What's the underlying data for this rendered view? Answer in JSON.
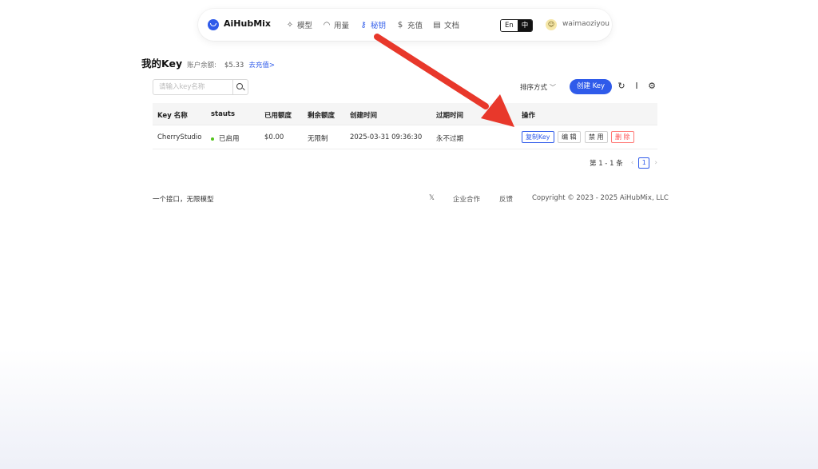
{
  "nav": {
    "brand": "AiHubMix",
    "items": [
      {
        "label": "模型",
        "icon": "sparkle-icon",
        "glyph": "✧",
        "active": false
      },
      {
        "label": "用量",
        "icon": "gauge-icon",
        "glyph": "◠",
        "active": false
      },
      {
        "label": "秘钥",
        "icon": "key-icon",
        "glyph": "⚷",
        "active": true
      },
      {
        "label": "充值",
        "icon": "coin-icon",
        "glyph": "$",
        "active": false
      },
      {
        "label": "文档",
        "icon": "document-icon",
        "glyph": "▤",
        "active": false
      }
    ],
    "lang_en": "En",
    "lang_zh": "中",
    "avatar_glyph": "☺",
    "username": "waimaoziyou"
  },
  "header": {
    "title": "我的Key",
    "balance_label": "账户余额:",
    "balance_value": "$5.33",
    "recharge_link": "去充值>"
  },
  "search": {
    "placeholder": "请输入key名称"
  },
  "toolbar": {
    "sort_label": "排序方式",
    "create_button": "创建 Key"
  },
  "table": {
    "headers": {
      "name": "Key 名称",
      "status": "stauts",
      "used": "已用额度",
      "remaining": "剩余额度",
      "created": "创建时间",
      "expires": "过期时间",
      "actions": "操作"
    },
    "rows": [
      {
        "name": "CherryStudio",
        "status": "已启用",
        "used": "$0.00",
        "remaining": "无限制",
        "created": "2025-03-31 09:36:30",
        "expires": "永不过期",
        "actions": {
          "copy": "复制Key",
          "edit": "编 辑",
          "disable": "禁 用",
          "delete": "删 除"
        }
      }
    ]
  },
  "pagination": {
    "summary": "第 1 - 1 条",
    "current_page": "1"
  },
  "footer": {
    "slogan": "一个接口，无限模型",
    "x_icon": "𝕏",
    "business": "企业合作",
    "feedback": "反馈",
    "copyright": "Copyright © 2023 - 2025 AiHubMix, LLC"
  },
  "colors": {
    "accent": "#2f5bea",
    "status_active": "#52c41a",
    "danger": "#ff4d4f",
    "annotation_arrow": "#e8382b"
  }
}
